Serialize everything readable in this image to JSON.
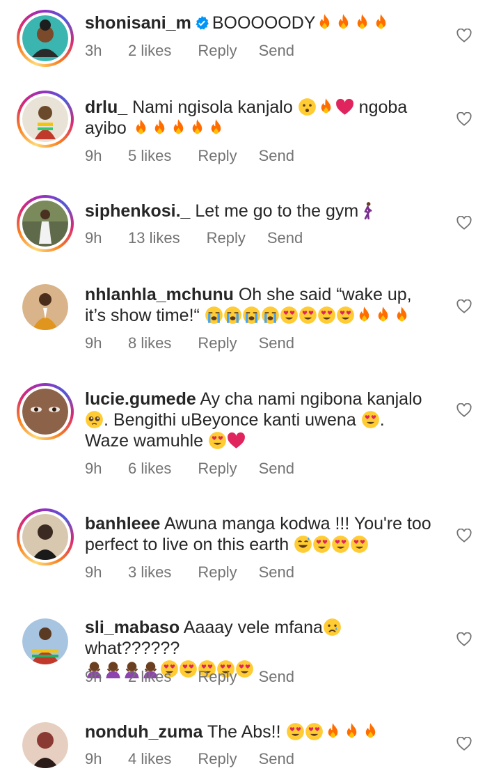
{
  "comments": [
    {
      "username": "shonisani_m",
      "verified": true,
      "text": "BOOOOODY",
      "emoji": [
        "fire",
        "fire",
        "fire",
        "fire"
      ],
      "text_after": "",
      "time": "3h",
      "likes": "2 likes",
      "reply": "Reply",
      "send": "Send",
      "story_ring": true,
      "avatar_color": "#3bb5b0"
    },
    {
      "username": "drlu_",
      "text": "Nami ngisola kanjalo",
      "emoji": [
        "hushed",
        "fire",
        "red-heart"
      ],
      "text_after": "ngoba ayibo",
      "emoji2": [
        "fire",
        "fire",
        "fire",
        "fire",
        "fire"
      ],
      "time": "9h",
      "likes": "5 likes",
      "reply": "Reply",
      "send": "Send",
      "story_ring": true,
      "avatar_color": "#6b4a2c"
    },
    {
      "username": "siphenkosi._",
      "text": "Let me go to the gym",
      "emoji": [
        "person-walking"
      ],
      "time": "9h",
      "likes": "13 likes",
      "reply": "Reply",
      "send": "Send",
      "story_ring": true,
      "avatar_color": "#5e6a4a"
    },
    {
      "username": "nhlanhla_mchunu",
      "text": "Oh she said “wake up, it’s show time!“",
      "emoji": [
        "loudly-crying",
        "loudly-crying",
        "loudly-crying",
        "loudly-crying",
        "heart-eyes",
        "heart-eyes",
        "heart-eyes",
        "heart-eyes",
        "fire",
        "fire",
        "fire"
      ],
      "time": "9h",
      "likes": "8 likes",
      "reply": "Reply",
      "send": "Send",
      "story_ring": false,
      "avatar_color": "#b77a1e"
    },
    {
      "username": "lucie.gumede",
      "text": "Ay cha nami ngibona kanjalo",
      "emoji": [
        "pleading"
      ],
      "text_after": ". Bengithi uBeyonce kanti uwena",
      "emoji2": [
        "heart-eyes"
      ],
      "text_after2": ". Waze wamuhle",
      "emoji3": [
        "heart-eyes",
        "red-heart"
      ],
      "time": "9h",
      "likes": "6 likes",
      "reply": "Reply",
      "send": "Send",
      "story_ring": true,
      "avatar_color": "#7b5a44"
    },
    {
      "username": "banhleee",
      "text": "Awuna manga kodwa !!! You're too perfect to live on this earth",
      "emoji": [
        "grinning-sweat",
        "heart-eyes",
        "heart-eyes",
        "heart-eyes"
      ],
      "time": "9h",
      "likes": "3 likes",
      "reply": "Reply",
      "send": "Send",
      "story_ring": true,
      "avatar_color": "#3a2a22"
    },
    {
      "username": "sli_mabaso",
      "text": "Aaaay vele mfana",
      "emoji": [
        "crying"
      ],
      "text_after": "what??????",
      "emoji2": [
        "person-gesturing",
        "person-gesturing",
        "person-gesturing",
        "person-gesturing",
        "heart-eyes",
        "heart-eyes",
        "heart-eyes",
        "heart-eyes",
        "heart-eyes"
      ],
      "time": "9h",
      "likes": "2 likes",
      "reply": "Reply",
      "send": "Send",
      "story_ring": false,
      "avatar_color": "#5b7fa8"
    },
    {
      "username": "nonduh_zuma",
      "text": "The Abs!!",
      "emoji": [
        "heart-eyes",
        "heart-eyes",
        "fire",
        "fire",
        "fire"
      ],
      "time": "9h",
      "likes": "4 likes",
      "reply": "Reply",
      "send": "Send",
      "story_ring": false,
      "avatar_color": "#8a3a32"
    }
  ],
  "colors": {
    "text": "#262626",
    "meta": "#737373",
    "verified": "#0095f6",
    "fire": "#ff6d00",
    "heart": "#e0245e",
    "face": "#ffcc33"
  }
}
